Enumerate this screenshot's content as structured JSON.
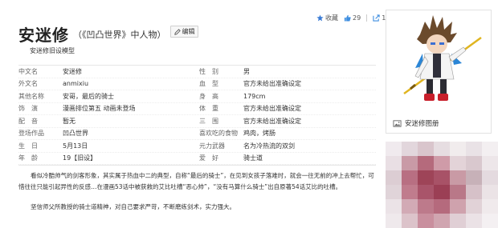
{
  "header": {
    "title": "安迷修",
    "subtitle": "（《凹凸世界》中人物）",
    "edit_label": "编辑",
    "model_note": "安迷修旧设模型"
  },
  "actions": {
    "collect_label": "收藏",
    "like_count": "29",
    "share_count": "1"
  },
  "info_rows": [
    {
      "k1": "中文名",
      "v1": "安迷修",
      "k2": "性　别",
      "v2": "男"
    },
    {
      "k1": "外文名",
      "v1": "anmixiu",
      "k2": "血　型",
      "v2": "官方未给出准确设定"
    },
    {
      "k1": "其他名称",
      "v1": "安哥，最后的骑士",
      "k2": "身　高",
      "v2": "179cm"
    },
    {
      "k1": "饰　演",
      "v1": "漫画排位第五 动画未登场",
      "k2": "体　重",
      "v2": "官方未给出准确设定"
    },
    {
      "k1": "配　音",
      "v1": "暂无",
      "k2": "三　围",
      "v2": "官方未给出准确设定"
    },
    {
      "k1": "登场作品",
      "v1": "凹凸世界",
      "k2": "喜欢吃的食物",
      "v2": "鸡肉，烤肠"
    },
    {
      "k1": "生　日",
      "v1": "5月13日",
      "k2": "元力武器",
      "v2": "名为冷热流的双剑"
    },
    {
      "k1": "年　龄",
      "v1": "19【旧设】",
      "k2": "爱　好",
      "v2": "骑士道"
    }
  ],
  "paragraphs": {
    "p1": "看似冷酷帅气的剑客形象，其实属于热血中二的典型，自称“最后的骑士”，在见到女孩子落难时，就会一往无前的冲上去帮忙，可惜往往只能引起异性的反感…在漫画53话中被获救的艾比吐槽“恶心帅”，“没有马算什么骑士”出自原著54话艾比的吐槽。",
    "p2": "坚信师父所教授的骑士道精神，对自己要求严苛，不断磨练剑术，实力强大。"
  },
  "side": {
    "album_label": "安迷修图册"
  },
  "colors": {
    "accent_blue": "#3e8ee0",
    "star_blue": "#3a7bd5"
  }
}
